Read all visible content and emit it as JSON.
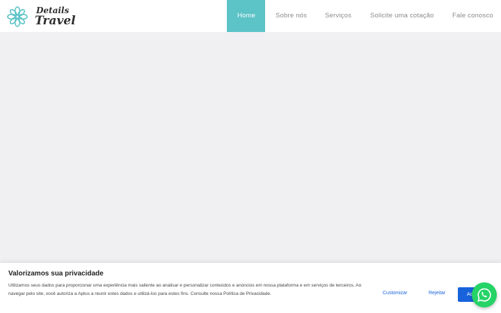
{
  "logo": {
    "line1": "Details",
    "line2": "Travel",
    "icon": "mandala-logo-icon",
    "accent": "#5cc3c7"
  },
  "nav": {
    "items": [
      {
        "label": "Home",
        "active": true
      },
      {
        "label": "Sobre nós"
      },
      {
        "label": "Serviços"
      },
      {
        "label": "Solicite uma cotação"
      },
      {
        "label": "Fale conosco"
      }
    ],
    "active_bg": "#5cc3c7"
  },
  "cookie": {
    "title": "Valorizamos sua privacidade",
    "text": "Utilizamos seus dados para proporcionar uma experiência mais saliente ao analisar e personalizar conteúdos e anúncios em nossa plataforma e em serviços de terceiros. Ao navegar pelo site, você autoriza a Aptus a reunir estes dados e utilizá-los para estes fins. Consulte nossa Política de Privacidade.",
    "customize_label": "Customizar",
    "reject_label": "Rejeitar",
    "accept_label": "Aceitar",
    "button_color": "#1863dc"
  },
  "whatsapp": {
    "icon": "whatsapp-icon",
    "color": "#25d366"
  }
}
